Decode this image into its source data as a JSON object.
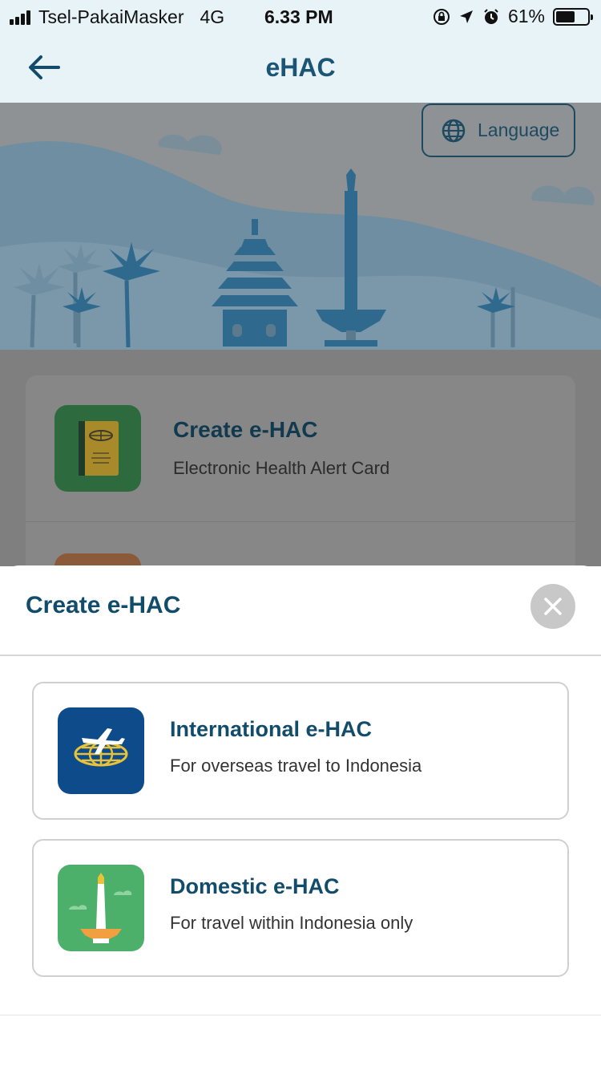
{
  "status_bar": {
    "carrier": "Tsel-PakaiMasker",
    "network": "4G",
    "time": "6.33 PM",
    "battery_percent": "61%",
    "battery_level": 0.61
  },
  "header": {
    "title": "eHAC"
  },
  "hero": {
    "language_label": "Language"
  },
  "background_menu": {
    "items": [
      {
        "title": "Create e-HAC",
        "subtitle": "Electronic Health Alert Card"
      }
    ]
  },
  "sheet": {
    "title": "Create e-HAC",
    "options": [
      {
        "title": "International e-HAC",
        "subtitle": "For overseas travel to Indonesia"
      },
      {
        "title": "Domestic e-HAC",
        "subtitle": "For travel within Indonesia only"
      }
    ]
  },
  "colors": {
    "accent": "#124c6b",
    "header_bg": "#e8f3f8",
    "international_icon_bg": "#0d4b8a",
    "domestic_icon_bg": "#4caf6a"
  }
}
